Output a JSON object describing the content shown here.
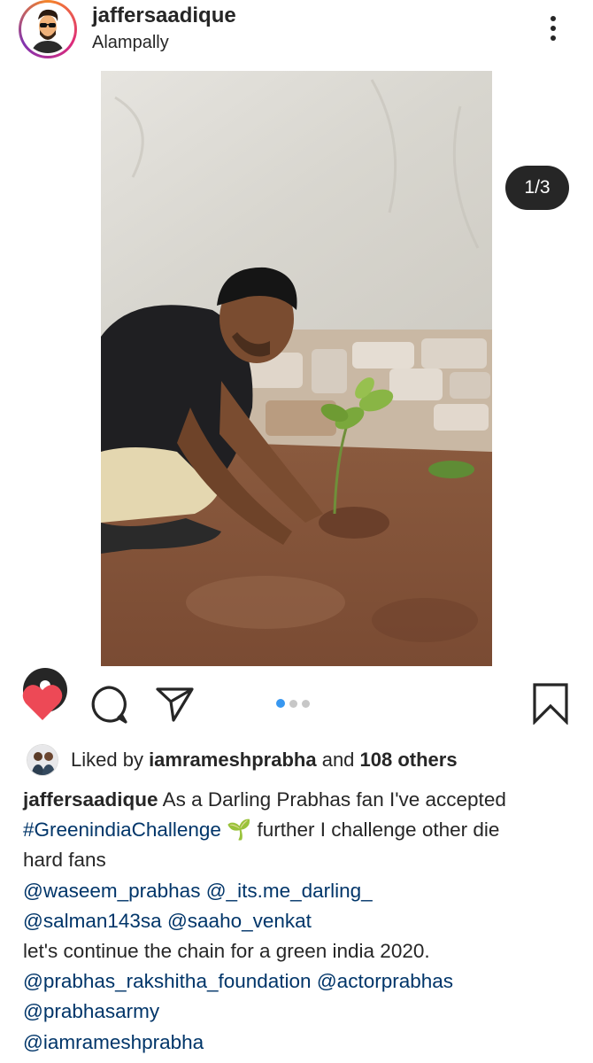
{
  "post": {
    "username": "jaffersaadique",
    "location": "Alampally",
    "image_counter": "1/3",
    "carousel": {
      "count": 3,
      "active_index": 0
    }
  },
  "likes": {
    "prefix": "Liked by ",
    "liker": "iamrameshprabha",
    "middle": " and ",
    "others": "108 others"
  },
  "caption": {
    "username": "jaffersaadique",
    "text1": " As a Darling Prabhas fan I've accepted",
    "hashtag": "#GreenindiaChallenge",
    "emoji": "🌱",
    "text2": " further I challenge other die",
    "text3": "hard fans",
    "mention1": "@waseem_prabhas",
    "mention2": "@_its.me_darling_",
    "mention3": "@salman143sa",
    "mention4": "@saaho_venkat",
    "text4": " let's continue the chain for a green india 2020.",
    "mention5": "@prabhas_rakshitha_foundation",
    "mention6": "@actorprabhas",
    "mention7": "@prabhasarmy",
    "mention8": "@iamrameshprabha"
  },
  "colors": {
    "heart": "#ed4956",
    "link": "#003569",
    "carousel_active": "#3897f0",
    "carousel_inactive": "#c7c7c7"
  },
  "icons": {
    "more": "more-vertical-icon",
    "like": "heart-filled-icon",
    "comment": "comment-icon",
    "share": "send-icon",
    "save": "bookmark-icon",
    "tags": "user-tag-icon"
  }
}
